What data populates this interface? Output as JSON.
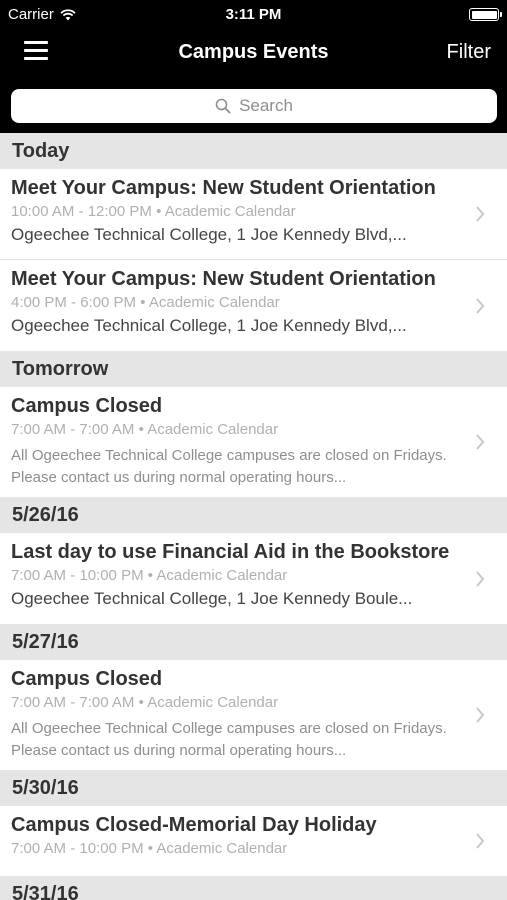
{
  "status_bar": {
    "carrier": "Carrier",
    "time": "3:11 PM"
  },
  "nav": {
    "title": "Campus Events",
    "filter_label": "Filter"
  },
  "search": {
    "placeholder": "Search"
  },
  "sections": [
    {
      "header": "Today",
      "events": [
        {
          "title": "Meet Your Campus: New Student Orientation",
          "time": "10:00 AM - 12:00 PM",
          "calendar": "Academic Calendar",
          "location": "Ogeechee Technical College, 1 Joe Kennedy Blvd,..."
        },
        {
          "title": "Meet Your Campus: New Student Orientation",
          "time": "4:00 PM - 6:00 PM",
          "calendar": "Academic Calendar",
          "location": "Ogeechee Technical College, 1 Joe Kennedy Blvd,..."
        }
      ]
    },
    {
      "header": "Tomorrow",
      "events": [
        {
          "title": "Campus Closed",
          "time": "7:00 AM - 7:00 AM",
          "calendar": "Academic Calendar",
          "description": "All Ogeechee Technical College campuses are closed on Fridays. Please contact us during normal operating hours..."
        }
      ]
    },
    {
      "header": "5/26/16",
      "events": [
        {
          "title": "Last day to use Financial Aid in the Bookstore",
          "time": "7:00 AM - 10:00 PM",
          "calendar": "Academic Calendar",
          "location": "Ogeechee Technical College, 1 Joe Kennedy Boule..."
        }
      ]
    },
    {
      "header": "5/27/16",
      "events": [
        {
          "title": "Campus Closed",
          "time": "7:00 AM - 7:00 AM",
          "calendar": "Academic Calendar",
          "description": "All Ogeechee Technical College campuses are closed on Fridays. Please contact us during normal operating hours..."
        }
      ]
    },
    {
      "header": "5/30/16",
      "events": [
        {
          "title": "Campus Closed-Memorial Day Holiday",
          "time": "7:00 AM - 10:00 PM",
          "calendar": "Academic Calendar"
        }
      ]
    },
    {
      "header": "5/31/16",
      "events": []
    }
  ],
  "meta_separator": "•",
  "icons": {
    "menu": "hamburger-menu-icon",
    "search": "magnifier-icon",
    "chevron": "chevron-right-icon",
    "wifi": "wifi-icon",
    "battery": "battery-icon"
  },
  "colors": {
    "nav_background": "#000000",
    "section_background": "#e5e5e5",
    "meta_text": "#b0b0b0"
  }
}
